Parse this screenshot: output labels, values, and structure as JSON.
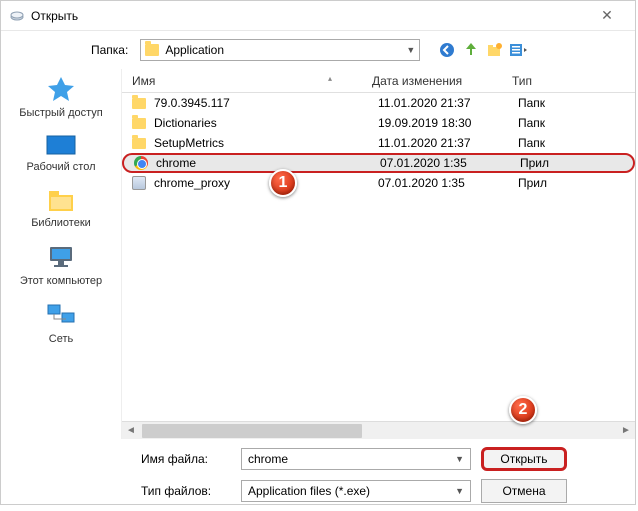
{
  "title": "Открыть",
  "folder": {
    "label": "Папка:",
    "value": "Application"
  },
  "sidebar": [
    {
      "label": "Быстрый доступ"
    },
    {
      "label": "Рабочий стол"
    },
    {
      "label": "Библиотеки"
    },
    {
      "label": "Этот компьютер"
    },
    {
      "label": "Сеть"
    }
  ],
  "columns": {
    "name": "Имя",
    "date": "Дата изменения",
    "type": "Тип"
  },
  "files": [
    {
      "name": "79.0.3945.117",
      "date": "11.01.2020 21:37",
      "type": "Папк",
      "kind": "folder"
    },
    {
      "name": "Dictionaries",
      "date": "19.09.2019 18:30",
      "type": "Папк",
      "kind": "folder"
    },
    {
      "name": "SetupMetrics",
      "date": "11.01.2020 21:37",
      "type": "Папк",
      "kind": "folder"
    },
    {
      "name": "chrome",
      "date": "07.01.2020 1:35",
      "type": "Прил",
      "kind": "chrome",
      "selected": true
    },
    {
      "name": "chrome_proxy",
      "date": "07.01.2020 1:35",
      "type": "Прил",
      "kind": "exe"
    }
  ],
  "filename": {
    "label": "Имя файла:",
    "value": "chrome"
  },
  "filetype": {
    "label": "Тип файлов:",
    "value": "Application files (*.exe)"
  },
  "buttons": {
    "open": "Открыть",
    "cancel": "Отмена"
  },
  "markers": {
    "m1": "1",
    "m2": "2"
  }
}
